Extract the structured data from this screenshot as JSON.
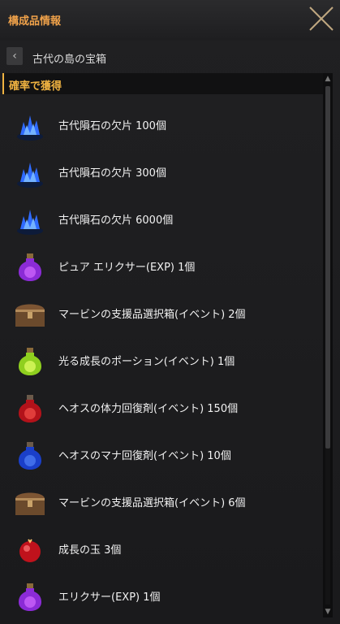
{
  "window": {
    "title": "構成品情報"
  },
  "breadcrumb": {
    "text": "古代の島の宝箱"
  },
  "section": {
    "title": "確率で獲得"
  },
  "items": [
    {
      "label": "古代隕石の欠片 100個",
      "icon": "blue-crystal-icon"
    },
    {
      "label": "古代隕石の欠片 300個",
      "icon": "blue-crystal-icon"
    },
    {
      "label": "古代隕石の欠片 6000個",
      "icon": "blue-crystal-icon"
    },
    {
      "label": "ピュア エリクサー(EXP) 1個",
      "icon": "purple-potion-icon"
    },
    {
      "label": "マービンの支援品選択箱(イベント) 2個",
      "icon": "treasure-chest-icon"
    },
    {
      "label": "光る成長のポーション(イベント) 1個",
      "icon": "green-potion-icon"
    },
    {
      "label": "ヘオスの体力回復剤(イベント) 150個",
      "icon": "red-potion-icon"
    },
    {
      "label": "ヘオスのマナ回復剤(イベント) 10個",
      "icon": "blue-potion-icon"
    },
    {
      "label": "マービンの支援品選択箱(イベント) 6個",
      "icon": "treasure-chest-icon"
    },
    {
      "label": "成長の玉 3個",
      "icon": "red-orb-icon"
    },
    {
      "label": "エリクサー(EXP) 1個",
      "icon": "purple-potion-icon"
    }
  ],
  "colors": {
    "accent": "#f0a24a",
    "section_accent": "#f0b341"
  }
}
